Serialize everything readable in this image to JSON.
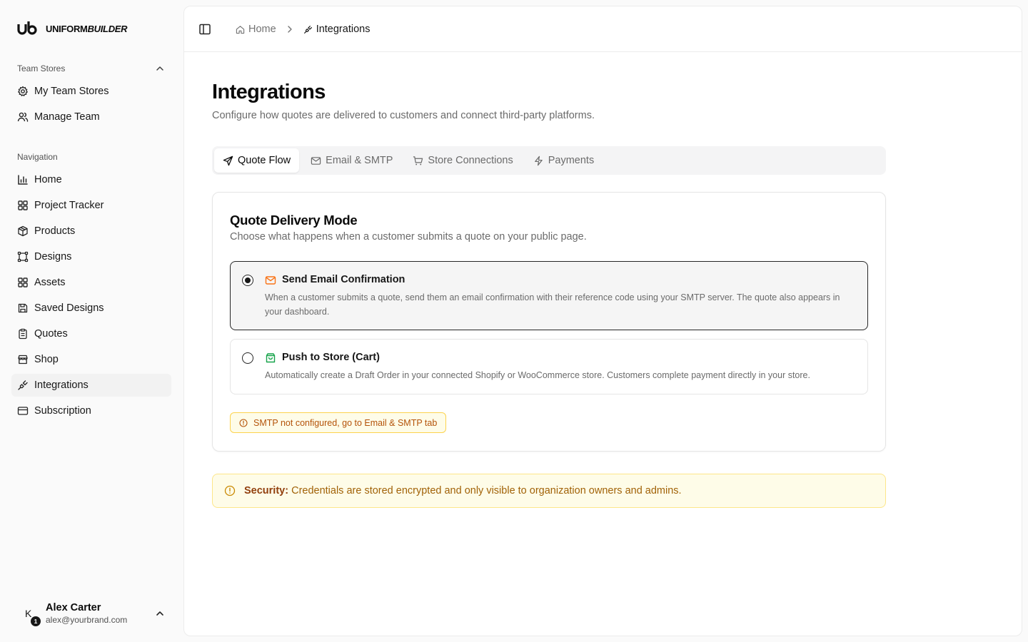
{
  "brand": {
    "name_a": "UNIFORM",
    "name_b": "BUILDER"
  },
  "sidebar": {
    "team_label": "Team Stores",
    "team_items": [
      {
        "label": "My Team Stores",
        "icon": "gear-icon"
      },
      {
        "label": "Manage Team",
        "icon": "users-icon"
      }
    ],
    "nav_label": "Navigation",
    "nav_items": [
      {
        "label": "Home",
        "icon": "bar-chart-icon"
      },
      {
        "label": "Project Tracker",
        "icon": "grid-icon"
      },
      {
        "label": "Products",
        "icon": "package-icon"
      },
      {
        "label": "Designs",
        "icon": "frame-icon"
      },
      {
        "label": "Assets",
        "icon": "grid-icon"
      },
      {
        "label": "Saved Designs",
        "icon": "save-icon"
      },
      {
        "label": "Quotes",
        "icon": "clipboard-icon"
      },
      {
        "label": "Shop",
        "icon": "store-icon"
      },
      {
        "label": "Integrations",
        "icon": "plug-icon",
        "active": true
      },
      {
        "label": "Subscription",
        "icon": "credit-card-icon"
      }
    ]
  },
  "user": {
    "initial": "K",
    "badge": "1",
    "name": "Alex Carter",
    "email": "alex@yourbrand.com"
  },
  "breadcrumb": {
    "home": "Home",
    "current": "Integrations"
  },
  "page": {
    "title": "Integrations",
    "subtitle": "Configure how quotes are delivered to customers and connect third-party platforms."
  },
  "tabs": [
    {
      "label": "Quote Flow",
      "icon": "send-icon",
      "active": true
    },
    {
      "label": "Email & SMTP",
      "icon": "mail-icon"
    },
    {
      "label": "Store Connections",
      "icon": "cart-icon"
    },
    {
      "label": "Payments",
      "icon": "bolt-icon"
    }
  ],
  "delivery": {
    "title": "Quote Delivery Mode",
    "subtitle": "Choose what happens when a customer submits a quote on your public page.",
    "options": [
      {
        "title": "Send Email Confirmation",
        "desc": "When a customer submits a quote, send them an email confirmation with their reference code using your SMTP server. The quote also appears in your dashboard.",
        "selected": true,
        "icon": "mail-icon",
        "icon_color": "#f97316"
      },
      {
        "title": "Push to Store (Cart)",
        "desc": "Automatically create a Draft Order in your connected Shopify or WooCommerce store. Customers complete payment directly in your store.",
        "selected": false,
        "icon": "shopping-bag-icon",
        "icon_color": "#16a34a"
      }
    ],
    "warning": "SMTP not configured, go to Email & SMTP tab"
  },
  "security": {
    "label": "Security:",
    "text": "Credentials are stored encrypted and only visible to organization owners and admins."
  }
}
